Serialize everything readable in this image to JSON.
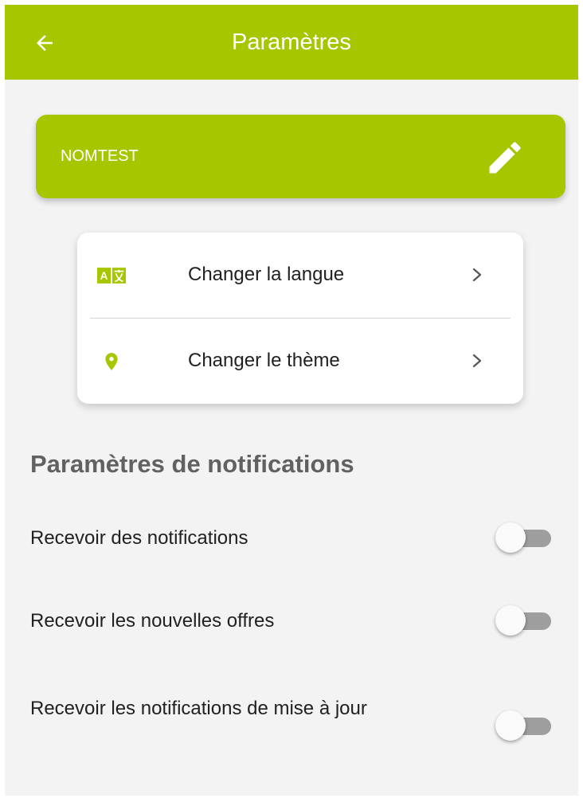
{
  "colors": {
    "primary": "#a6c600",
    "background": "#f3f3f3",
    "card": "#ffffff",
    "toggle_off_track": "#9e9e9e"
  },
  "appbar": {
    "title": "Paramètres",
    "back_icon": "arrow-left-icon"
  },
  "profile": {
    "name": "NOMTEST",
    "edit_icon": "pencil-icon"
  },
  "settings": {
    "items": [
      {
        "label": "Changer la langue",
        "icon": "translate-icon"
      },
      {
        "label": "Changer le thème",
        "icon": "map-pin-icon"
      }
    ]
  },
  "notifications": {
    "title": "Paramètres de notifications",
    "items": [
      {
        "label": "Recevoir des notifications",
        "enabled": false
      },
      {
        "label": "Recevoir les nouvelles offres",
        "enabled": false
      },
      {
        "label": "Recevoir les notifications de mise à jour",
        "enabled": false
      }
    ]
  }
}
